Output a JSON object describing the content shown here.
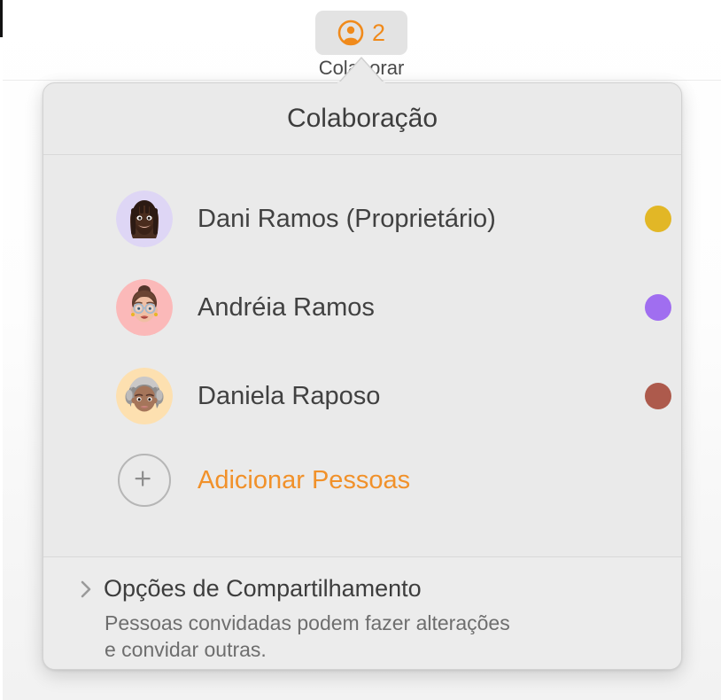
{
  "toolbar": {
    "collaborate_button": {
      "icon": "person-circle-icon",
      "count": "2",
      "label": "Colaborar",
      "icon_color": "#f08a1b",
      "background": "#e3e3e3"
    }
  },
  "popover": {
    "title": "Colaboração",
    "people": [
      {
        "name": "Dani Ramos (Proprietário)",
        "avatar": "memoji-dreadlocks-beard",
        "avatar_bg": "#ded6f5",
        "status_color": "#e2b726"
      },
      {
        "name": "Andréia Ramos",
        "avatar": "memoji-updo-glasses",
        "avatar_bg": "#fbb9b9",
        "status_color": "#a06ef0"
      },
      {
        "name": "Daniela Raposo",
        "avatar": "memoji-gray-wavy-hair",
        "avatar_bg": "#fde0b0",
        "status_color": "#ad5a4c"
      }
    ],
    "add_people": {
      "icon": "plus-icon",
      "label": "Adicionar Pessoas",
      "color": "#f1912a"
    },
    "footer": {
      "disclosure_icon": "chevron-right-icon",
      "share_options_label": "Opções de Compartilhamento",
      "description": "Pessoas convidadas podem fazer alterações\ne convidar outras."
    }
  }
}
